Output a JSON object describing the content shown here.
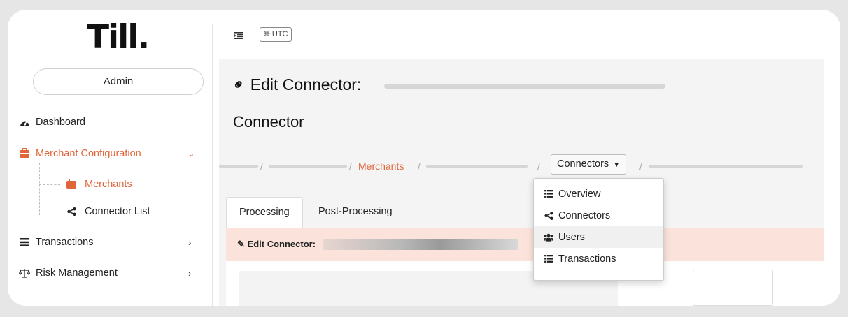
{
  "brand": {
    "logo": "Till."
  },
  "sidebar": {
    "role": "Admin",
    "items": [
      {
        "label": "Dashboard",
        "icon": "dashboard-icon"
      },
      {
        "label": "Merchant Configuration",
        "icon": "briefcase-icon",
        "expanded": true,
        "chevron": "⌄"
      },
      {
        "label": "Transactions",
        "icon": "list-icon",
        "chevron": "›"
      },
      {
        "label": "Risk Management",
        "icon": "scale-icon",
        "chevron": "›"
      }
    ],
    "subitems": [
      {
        "label": "Merchants",
        "icon": "briefcase-icon",
        "active": true
      },
      {
        "label": "Connector List",
        "icon": "share-icon"
      }
    ]
  },
  "topbar": {
    "timezone": "UTC"
  },
  "page": {
    "title_prefix": "Edit Connector:",
    "title_line2": "Connector",
    "breadcrumb": {
      "merchants": "Merchants",
      "connectors_button": "Connectors"
    },
    "tabs": [
      {
        "label": "Processing",
        "active": true
      },
      {
        "label": "Post-Processing"
      }
    ],
    "panel_title": "Edit Connector:"
  },
  "dropdown": {
    "items": [
      {
        "label": "Overview",
        "icon": "list-icon"
      },
      {
        "label": "Connectors",
        "icon": "share-icon"
      },
      {
        "label": "Users",
        "icon": "users-icon",
        "hover": true
      },
      {
        "label": "Transactions",
        "icon": "list-icon"
      }
    ]
  },
  "colors": {
    "accent": "#e0653a",
    "panel_head": "#fbe3db",
    "content_bg": "#f4f4f4"
  }
}
